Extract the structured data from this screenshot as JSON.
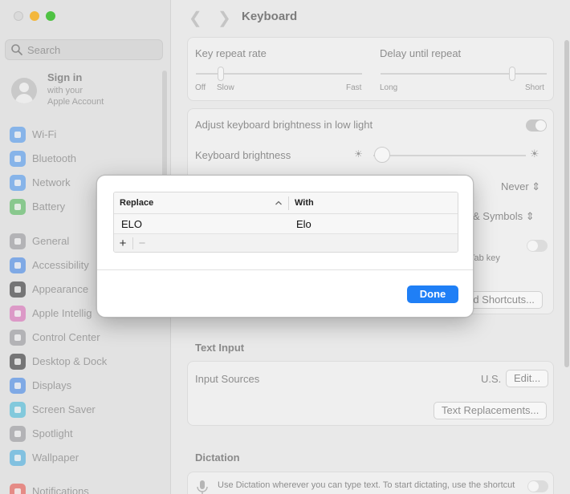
{
  "window": {
    "title": "Keyboard"
  },
  "sidebar": {
    "search_placeholder": "Search",
    "account": {
      "title": "Sign in",
      "line1": "with your",
      "line2": "Apple Account"
    },
    "items": [
      {
        "label": "Wi-Fi",
        "icon": "wifi-icon",
        "color": "#3d8fef"
      },
      {
        "label": "Bluetooth",
        "icon": "bluetooth-icon",
        "color": "#3d8fef"
      },
      {
        "label": "Network",
        "icon": "network-icon",
        "color": "#3d8fef"
      },
      {
        "label": "Battery",
        "icon": "battery-icon",
        "color": "#41b34a"
      },
      {
        "label": "General",
        "icon": "gear-icon",
        "color": "#8e8e93"
      },
      {
        "label": "Accessibility",
        "icon": "accessibility-icon",
        "color": "#2f7be8"
      },
      {
        "label": "Appearance",
        "icon": "appearance-icon",
        "color": "#1d1d1f"
      },
      {
        "label": "Apple Intellig",
        "icon": "apple-intelligence-icon",
        "color": "#d85fb1"
      },
      {
        "label": "Control Center",
        "icon": "control-center-icon",
        "color": "#8e8e93"
      },
      {
        "label": "Desktop & Dock",
        "icon": "dock-icon",
        "color": "#1d1d1f"
      },
      {
        "label": "Displays",
        "icon": "displays-icon",
        "color": "#2f7be8"
      },
      {
        "label": "Screen Saver",
        "icon": "screen-saver-icon",
        "color": "#35b5d8"
      },
      {
        "label": "Spotlight",
        "icon": "spotlight-icon",
        "color": "#8e8e93"
      },
      {
        "label": "Wallpaper",
        "icon": "wallpaper-icon",
        "color": "#35a7e0"
      },
      {
        "label": "Notifications",
        "icon": "notifications-icon",
        "color": "#e8453c"
      }
    ]
  },
  "keyboard": {
    "key_repeat_rate": {
      "label": "Key repeat rate",
      "min": "Off",
      "slow": "Slow",
      "fast": "Fast"
    },
    "delay_until_repeat": {
      "label": "Delay until repeat",
      "long": "Long",
      "short": "Short"
    },
    "adjust_brightness_label": "Adjust keyboard brightness in low light",
    "brightness_label": "Keyboard brightness",
    "turn_off_value": "Never",
    "globe_key_value": "& Symbols",
    "tab_key_text": "e Tab key",
    "shortcuts_button": "rd Shortcuts..."
  },
  "text_input": {
    "heading": "Text Input",
    "input_sources_label": "Input Sources",
    "input_sources_value": "U.S.",
    "edit_button": "Edit...",
    "text_replacements_button": "Text Replacements..."
  },
  "dictation": {
    "heading": "Dictation",
    "description": "Use Dictation wherever you can type text. To start dictating, use the shortcut"
  },
  "sheet": {
    "columns": {
      "replace": "Replace",
      "with": "With"
    },
    "rows": [
      {
        "replace": "ELO",
        "with": "Elo"
      }
    ],
    "add_button": "+",
    "remove_button": "−",
    "done_button": "Done",
    "accent": "#1f7ff6"
  }
}
